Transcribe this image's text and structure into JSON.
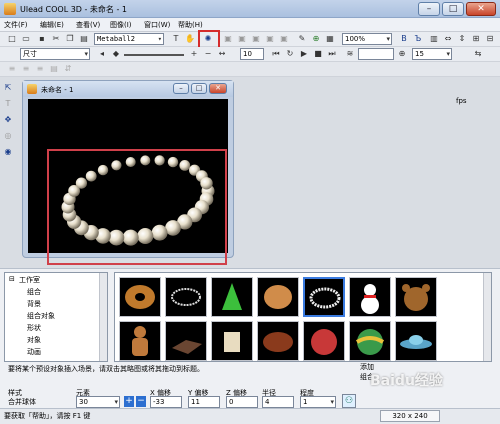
{
  "window": {
    "title": "Ulead COOL 3D - 未命名 - 1",
    "minimize": "–",
    "maximize": "□",
    "close": "✕"
  },
  "menu": [
    "文件(F)",
    "编辑(E)",
    "查看(V)",
    "图像(I)",
    "窗口(W)",
    "帮助(H)"
  ],
  "toolbar1": {
    "font_value": "Metaball2",
    "zoom_value": "100%"
  },
  "toolbar2": {
    "size_value": "尺寸",
    "frame_value": "10",
    "fps_value": "15",
    "fps_unit": "fps"
  },
  "child_window": {
    "title": "未命名 - 1"
  },
  "tree": {
    "root": "工作室",
    "items": [
      "组合",
      "背景",
      "组合对象",
      "形状",
      "对象",
      "动画"
    ]
  },
  "hint": "要将某个预设对象插入场景，请双击其略图或将其拖动到标题。",
  "add_label": "添加",
  "add_sublabel": "组合",
  "bottom": {
    "style_label": "样式",
    "style_value": "合并球体",
    "elements_label": "元素",
    "elements_value": "30",
    "x_offset_label": "X 偏移",
    "x_offset_value": "-33",
    "y_offset_label": "Y 偏移",
    "y_offset_value": "11",
    "z_offset_label": "Z 偏移",
    "z_offset_value": "0",
    "radius_label": "半径",
    "radius_value": "4",
    "degree_label": "程度",
    "degree_value": "1"
  },
  "status": {
    "text": "要获取「帮助」，请按 F1 键",
    "size": "320 x 240"
  },
  "watermark": "Baidu经验"
}
